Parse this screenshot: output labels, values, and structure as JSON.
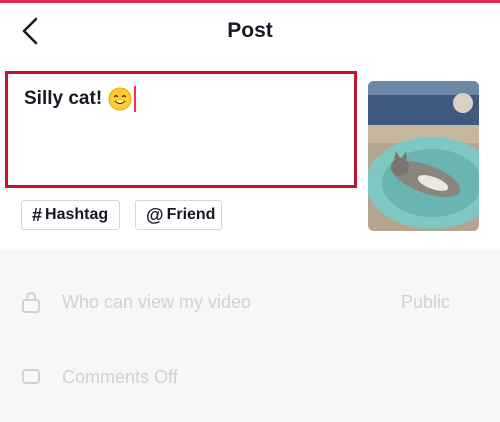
{
  "header": {
    "title": "Post"
  },
  "caption": {
    "text": "Silly cat!",
    "emoji": "smiling-face-emoji"
  },
  "chips": [
    {
      "symbol": "#",
      "label": "Hashtag"
    },
    {
      "symbol": "@",
      "label": "Friend"
    }
  ],
  "settings": {
    "view": {
      "label": "Who can view my video",
      "value": "Public",
      "icon": "lock-icon"
    },
    "comments": {
      "label": "Comments Off",
      "icon": "comment-icon"
    }
  },
  "colors": {
    "accent": "#fe2c55",
    "border_active": "#c0152f",
    "muted_text": "#d2d2d6"
  }
}
